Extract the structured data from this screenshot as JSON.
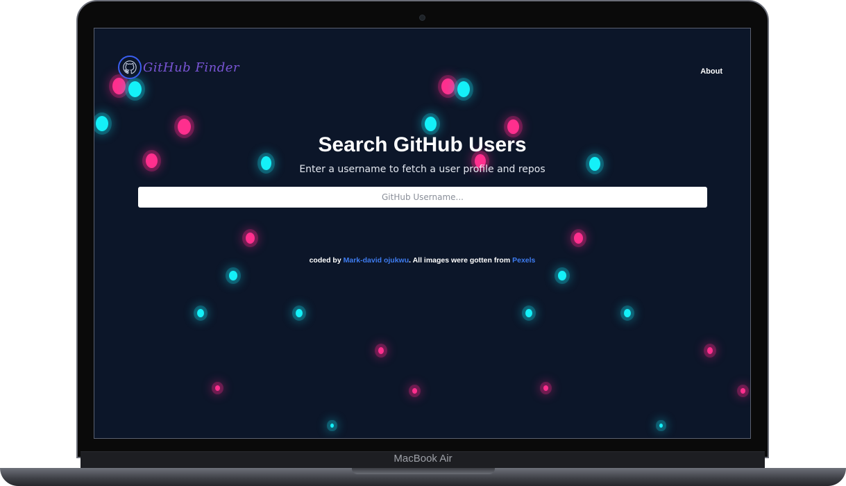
{
  "device": {
    "label": "MacBook Air"
  },
  "header": {
    "logo_text": "GitHub Finder",
    "logo_icon": "github-octocat-icon",
    "nav_about": "About"
  },
  "hero": {
    "title": "Search GitHub Users",
    "subtitle": "Enter a username to fetch a user profile and repos"
  },
  "search": {
    "placeholder": "GitHub Username...",
    "value": ""
  },
  "footer": {
    "prefix": "coded by ",
    "author": "Mark-david ojukwu",
    "middle": ". All images were gotten from ",
    "source": "Pexels"
  },
  "colors": {
    "background": "#0c1629",
    "cyan_glow": "#14f0f8",
    "pink_glow": "#ff2f8e",
    "link": "#3e7cf0",
    "logo": "#7a55d6"
  }
}
